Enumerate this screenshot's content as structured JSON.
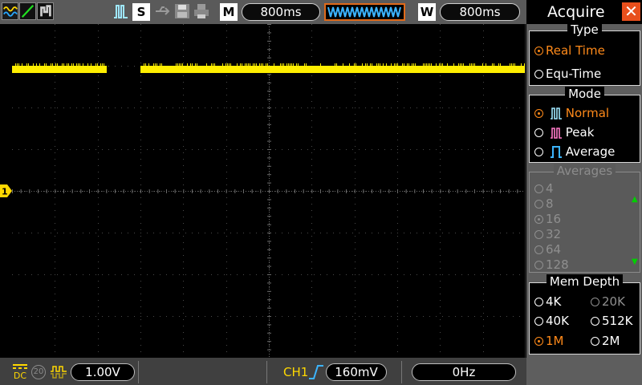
{
  "topbar": {
    "timebase_letter": "M",
    "timebase": "800ms",
    "window_letter": "W",
    "window_timebase": "800ms",
    "trigger_mode_letter": "S"
  },
  "bottombar": {
    "coupling": "DC",
    "bw_limit": "20",
    "ch1_scale": "1.00V",
    "trigger_source": "CH1",
    "trigger_level": "160mV",
    "frequency": "0Hz"
  },
  "menu": {
    "title": "Acquire",
    "type": {
      "title": "Type",
      "options": [
        {
          "label": "Real Time",
          "selected": true
        },
        {
          "label": "Equ-Time",
          "selected": false
        }
      ]
    },
    "mode": {
      "title": "Mode",
      "options": [
        {
          "label": "Normal",
          "selected": true
        },
        {
          "label": "Peak",
          "selected": false
        },
        {
          "label": "Average",
          "selected": false
        }
      ]
    },
    "averages": {
      "title": "Averages",
      "options": [
        "4",
        "8",
        "16",
        "32",
        "64",
        "128"
      ],
      "selected": "16"
    },
    "mem_depth": {
      "title": "Mem Depth",
      "options": [
        "4K",
        "20K",
        "40K",
        "512K",
        "1M",
        "2M"
      ],
      "selected": "1M"
    }
  },
  "colors": {
    "trace": "#ffee00",
    "selected": "#ff8a1a",
    "channel": "#ffd800",
    "close": "#e84f1c"
  },
  "trace": {
    "gap_start_fraction": 0.185,
    "gap_end_fraction": 0.25
  }
}
